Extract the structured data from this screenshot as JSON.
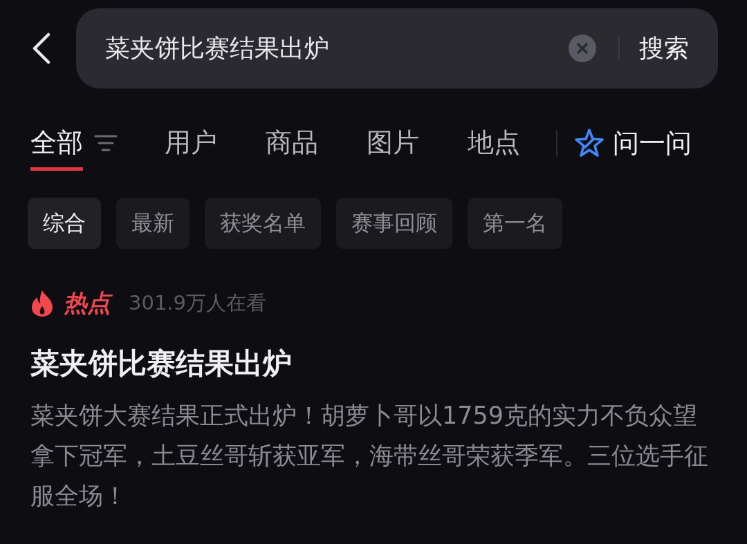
{
  "search": {
    "value": "菜夹饼比赛结果出炉",
    "button": "搜索"
  },
  "tabs": [
    {
      "label": "全部",
      "selected": true
    },
    {
      "label": "用户",
      "selected": false
    },
    {
      "label": "商品",
      "selected": false
    },
    {
      "label": "图片",
      "selected": false
    },
    {
      "label": "地点",
      "selected": false
    }
  ],
  "ask": {
    "label": "问一问"
  },
  "chips": [
    {
      "label": "综合",
      "selected": true
    },
    {
      "label": "最新",
      "selected": false
    },
    {
      "label": "获奖名单",
      "selected": false
    },
    {
      "label": "赛事回顾",
      "selected": false
    },
    {
      "label": "第一名",
      "selected": false
    }
  ],
  "result": {
    "badge": "热点",
    "viewers": "301.9万人在看",
    "title": "菜夹饼比赛结果出炉",
    "summary": "菜夹饼大赛结果正式出炉！胡萝卜哥以1759克的实力不负众望拿下冠军，土豆丝哥斩获亚军，海带丝哥荣获季军。三位选手征服全场！"
  }
}
